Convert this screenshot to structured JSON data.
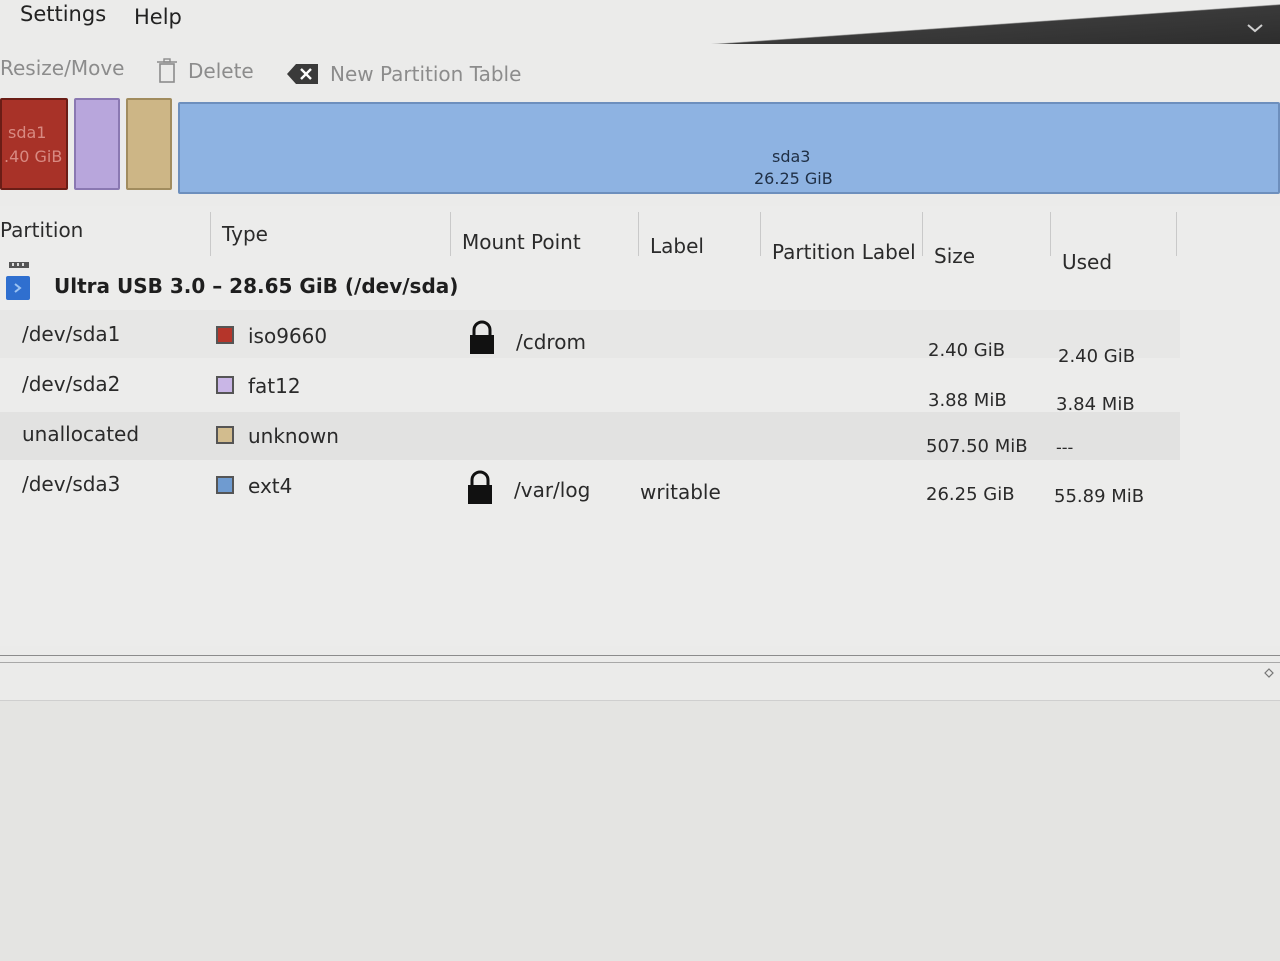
{
  "menu": {
    "items": [
      "Settings",
      "Help"
    ]
  },
  "toolbar": {
    "resize_move": "Resize/Move",
    "delete": "Delete",
    "new_partition_table": "New Partition Table"
  },
  "partition_bar": {
    "sda1": {
      "name": "sda1",
      "size": ".40 GiB",
      "color": "#a83228"
    },
    "sda2": {
      "color": "#b8a6dc"
    },
    "unallocated": {
      "color": "#cdb686"
    },
    "sda3": {
      "name": "sda3",
      "size": "26.25 GiB",
      "color": "#8eb3e2"
    }
  },
  "table": {
    "headers": [
      "Partition",
      "Type",
      "Mount Point",
      "Label",
      "Partition Label",
      "Size",
      "Used"
    ],
    "device": "Ultra USB 3.0 – 28.65 GiB (/dev/sda)",
    "rows": [
      {
        "partition": "/dev/sda1",
        "type": "iso9660",
        "type_color": "#b5352a",
        "mount": "/cdrom",
        "locked": true,
        "label": "",
        "size": "2.40 GiB",
        "used": "2.40 GiB"
      },
      {
        "partition": "/dev/sda2",
        "type": "fat12",
        "type_color": "#c9b6e6",
        "mount": "",
        "locked": false,
        "label": "",
        "size": "3.88 MiB",
        "used": "3.84 MiB"
      },
      {
        "partition": "unallocated",
        "type": "unknown",
        "type_color": "#d2bc8e",
        "mount": "",
        "locked": false,
        "label": "",
        "size": "507.50 MiB",
        "used": "---"
      },
      {
        "partition": "/dev/sda3",
        "type": "ext4",
        "type_color": "#6f9bd0",
        "mount": "/var/log",
        "locked": true,
        "label": "writable",
        "size": "26.25 GiB",
        "used": "55.89 MiB"
      }
    ]
  }
}
